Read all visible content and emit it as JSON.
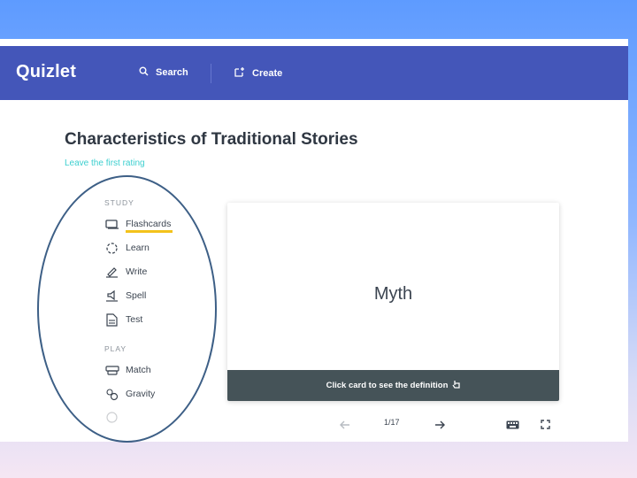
{
  "header": {
    "logo": "Quizlet",
    "search_label": "Search",
    "create_label": "Create"
  },
  "set": {
    "title": "Characteristics of Traditional Stories",
    "rating_link": "Leave the first rating"
  },
  "sidebar": {
    "study_label": "STUDY",
    "study_modes": [
      {
        "label": "Flashcards",
        "icon": "flashcards-icon"
      },
      {
        "label": "Learn",
        "icon": "learn-icon"
      },
      {
        "label": "Write",
        "icon": "write-icon"
      },
      {
        "label": "Spell",
        "icon": "spell-icon"
      },
      {
        "label": "Test",
        "icon": "test-icon"
      }
    ],
    "play_label": "PLAY",
    "play_modes": [
      {
        "label": "Match",
        "icon": "match-icon"
      },
      {
        "label": "Gravity",
        "icon": "gravity-icon"
      }
    ],
    "active_mode": "Flashcards"
  },
  "card": {
    "term": "Myth",
    "footer_text": "Click card to see the definition"
  },
  "controls": {
    "counter": "1/17"
  },
  "colors": {
    "header_bg": "#4456b9",
    "accent_underline": "#f3c21b",
    "rating_link": "#3ccfcf",
    "card_footer_bg": "#455358",
    "annotation_oval": "#3d5f86"
  }
}
